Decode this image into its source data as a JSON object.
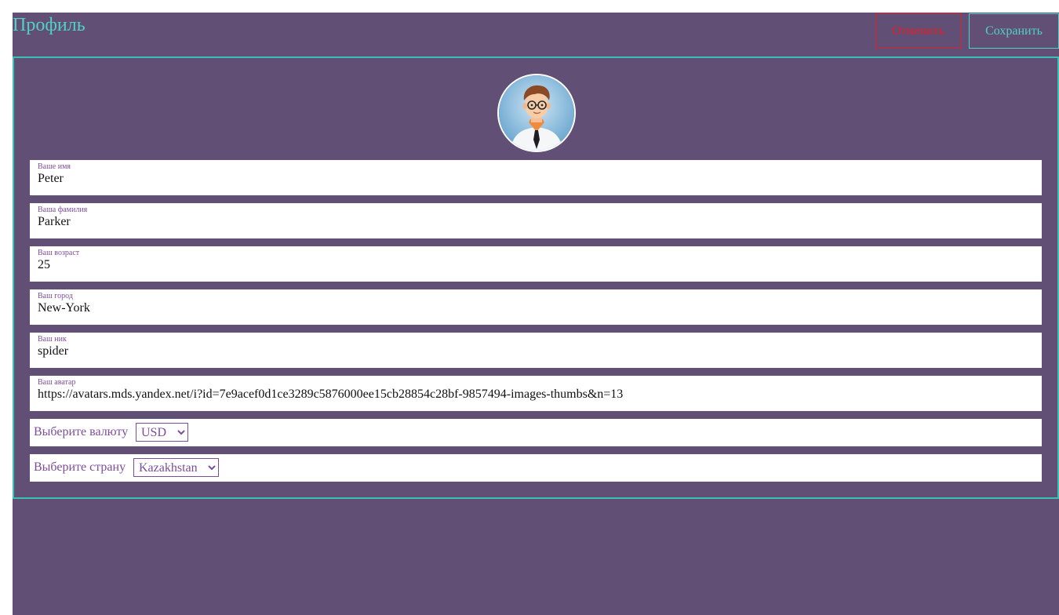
{
  "header": {
    "title": "Профиль",
    "cancel_label": "Отменить",
    "save_label": "Сохранить"
  },
  "colors": {
    "background": "#624f75",
    "accent": "#4fd1c5",
    "danger": "#e0202a",
    "label": "#7c4d9a"
  },
  "avatar": {
    "icon": "user-avatar"
  },
  "fields": [
    {
      "label": "Ваше имя",
      "value": "Peter"
    },
    {
      "label": "Ваша фамилия",
      "value": "Parker"
    },
    {
      "label": "Ваш возраст",
      "value": "25"
    },
    {
      "label": "Ваш город",
      "value": "New-York"
    },
    {
      "label": "Ваш ник",
      "value": "spider"
    },
    {
      "label": "Ваш аватар",
      "value": "https://avatars.mds.yandex.net/i?id=7e9acef0d1ce3289c5876000ee15cb28854c28bf-9857494-images-thumbs&n=13"
    }
  ],
  "currency": {
    "label": "Выберите валюту",
    "selected": "USD"
  },
  "country": {
    "label": "Выберите страну",
    "selected": "Kazakhstan"
  }
}
